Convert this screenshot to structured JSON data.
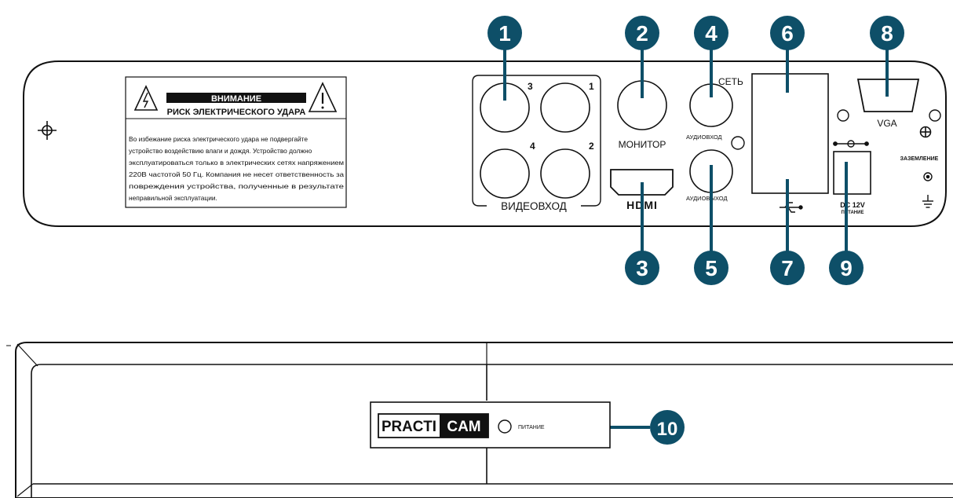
{
  "colors": {
    "callout": "#0e4f68",
    "line": "#111111",
    "logo_dark": "#111111"
  },
  "back_panel": {
    "warning": {
      "title": "ВНИМАНИЕ",
      "subtitle": "РИСК ЭЛЕКТРИЧЕСКОГО УДАРА",
      "body_lines": [
        "Во избежание риска электрического удара не подвергайте",
        "устройство воздействию влаги и дождя. Устройство должно",
        "эксплуатироваться только в электрических сетях напряжением",
        "220В частотой 50 Гц. Компания не несет ответственность за",
        "повреждения устройства, полученные в результате",
        "неправильной эксплуатации."
      ]
    },
    "video_in": {
      "label": "ВИДЕОВХОД",
      "ports": [
        "3",
        "1",
        "4",
        "2"
      ]
    },
    "monitor_label": "МОНИТОР",
    "hdmi_label": "HDMI",
    "audio_in_label": "АУДИОВХОД",
    "audio_out_label": "АУДИОВЫХОД",
    "network_label": "СЕТЬ",
    "vga_label": "VGA",
    "ground_label": "ЗАЗЕМЛЕНИЕ",
    "dc_label": "DC 12V",
    "power_label": "ПИТАНИЕ"
  },
  "front_panel": {
    "logo_left": "PRACTI",
    "logo_right": "CAM",
    "power_label": "ПИТАНИЕ"
  },
  "callouts": [
    "1",
    "2",
    "3",
    "4",
    "5",
    "6",
    "7",
    "8",
    "9",
    "10"
  ]
}
